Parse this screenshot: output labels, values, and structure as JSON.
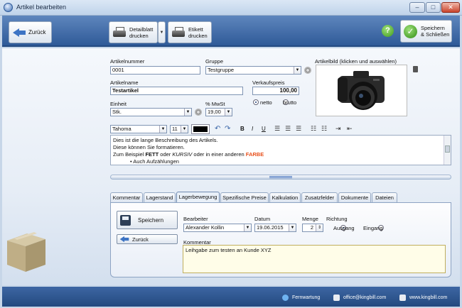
{
  "window": {
    "title": "Artikel bearbeiten",
    "minimize": "–",
    "maximize": "□",
    "close": "✕"
  },
  "toolbar": {
    "back_label": "Zurück",
    "detail_print_line1": "Detailblatt",
    "detail_print_line2": "drucken",
    "label_print_line1": "Etikett",
    "label_print_line2": "drucken",
    "help": "?",
    "save_close_line1": "Speichern",
    "save_close_line2": "& Schließen"
  },
  "form": {
    "article_number_label": "Artikelnummer",
    "article_number_value": "0001",
    "group_label": "Gruppe",
    "group_value": "Testgruppe",
    "article_name_label": "Artikelname",
    "article_name_value": "Testartikel",
    "sale_price_label": "Verkaufspreis",
    "sale_price_value": "100,00",
    "net_label": "netto",
    "gross_label": "brutto",
    "price_mode_selected": "netto",
    "unit_label": "Einheit",
    "unit_value": "Stk.",
    "vat_label": "% MwSt",
    "vat_value": "19,00",
    "image_label": "Artikelbild (klicken und auswählen)"
  },
  "editor": {
    "font": "Tahoma",
    "size": "11",
    "bold": "B",
    "italic": "I",
    "underline": "U",
    "line1": "Dies ist die lange Beschreibung des Artikels.",
    "line2": "Diese können Sie formatieren.",
    "line3_a": "Zum Beispiel ",
    "line3_bold": "FETT",
    "line3_b": " oder ",
    "line3_italic": "KURSIV",
    "line3_c": " oder in einer anderen ",
    "line3_color": "FARBE",
    "line4": "Auch Aufzählungen",
    "accent_color": "#e8501c"
  },
  "tabs": [
    {
      "label": "Kommentar"
    },
    {
      "label": "Lagerstand"
    },
    {
      "label": "Lagerbewegung"
    },
    {
      "label": "Spezifische Preise"
    },
    {
      "label": "Kalkulation"
    },
    {
      "label": "Zusatzfelder"
    },
    {
      "label": "Dokumente"
    },
    {
      "label": "Dateien"
    }
  ],
  "active_tab": "Lagerbewegung",
  "stock_movement": {
    "save_label": "Speichern",
    "back_label": "Zurück",
    "editor_label": "Bearbeiter",
    "editor_value": "Alexander Kollin",
    "date_label": "Datum",
    "date_value": "19.06.2015",
    "quantity_label": "Menge",
    "quantity_value": "2",
    "direction_label": "Richtung",
    "out_label": "Ausgang",
    "in_label": "Eingang",
    "direction_selected": "Ausgang",
    "comment_label": "Kommentar",
    "comment_value": "Leihgabe zum testen an Kunde XYZ"
  },
  "statusbar": {
    "remote": "Fernwartung",
    "email": "office@kingbill.com",
    "web": "www.kingbill.com"
  },
  "colors": {
    "toolbar": "#2f5a98",
    "accent_green": "#3e9a1c",
    "statusbar": "#23497f"
  }
}
